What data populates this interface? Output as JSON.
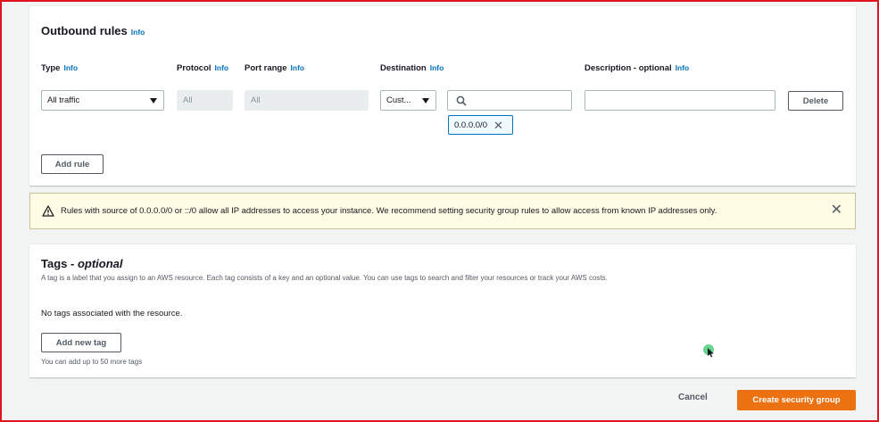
{
  "outbound": {
    "title": "Outbound rules",
    "info": "Info",
    "headers": {
      "type": "Type",
      "protocol": "Protocol",
      "port_range": "Port range",
      "destination": "Destination",
      "description": "Description - optional"
    },
    "rule": {
      "type_value": "All traffic",
      "protocol_value": "All",
      "port_value": "All",
      "destination_select": "Cust...",
      "search_value": "",
      "description_value": "",
      "token": "0.0.0.0/0",
      "delete_label": "Delete"
    },
    "add_rule_label": "Add rule"
  },
  "alert": {
    "text": "Rules with source of 0.0.0.0/0 or ::/0 allow all IP addresses to access your instance. We recommend setting security group rules to allow access from known IP addresses only.",
    "close": "✕"
  },
  "tags": {
    "title_main": "Tags - ",
    "title_optional": "optional",
    "description": "A tag is a label that you assign to an AWS resource. Each tag consists of a key and an optional value. You can use tags to search and filter your resources or track your AWS costs.",
    "empty_text": "No tags associated with the resource.",
    "add_label": "Add new tag",
    "limit_text": "You can add up to 50 more tags"
  },
  "footer": {
    "cancel_label": "Cancel",
    "create_label": "Create security group"
  },
  "colors": {
    "primary": "#ec7211",
    "link": "#0073bb",
    "warning_bg": "#fffce6",
    "frame": "#e0141e"
  },
  "icons": [
    "caret-down-icon",
    "search-icon",
    "remove-token-icon",
    "warning-icon",
    "close-icon",
    "mouse-pointer-icon"
  ]
}
